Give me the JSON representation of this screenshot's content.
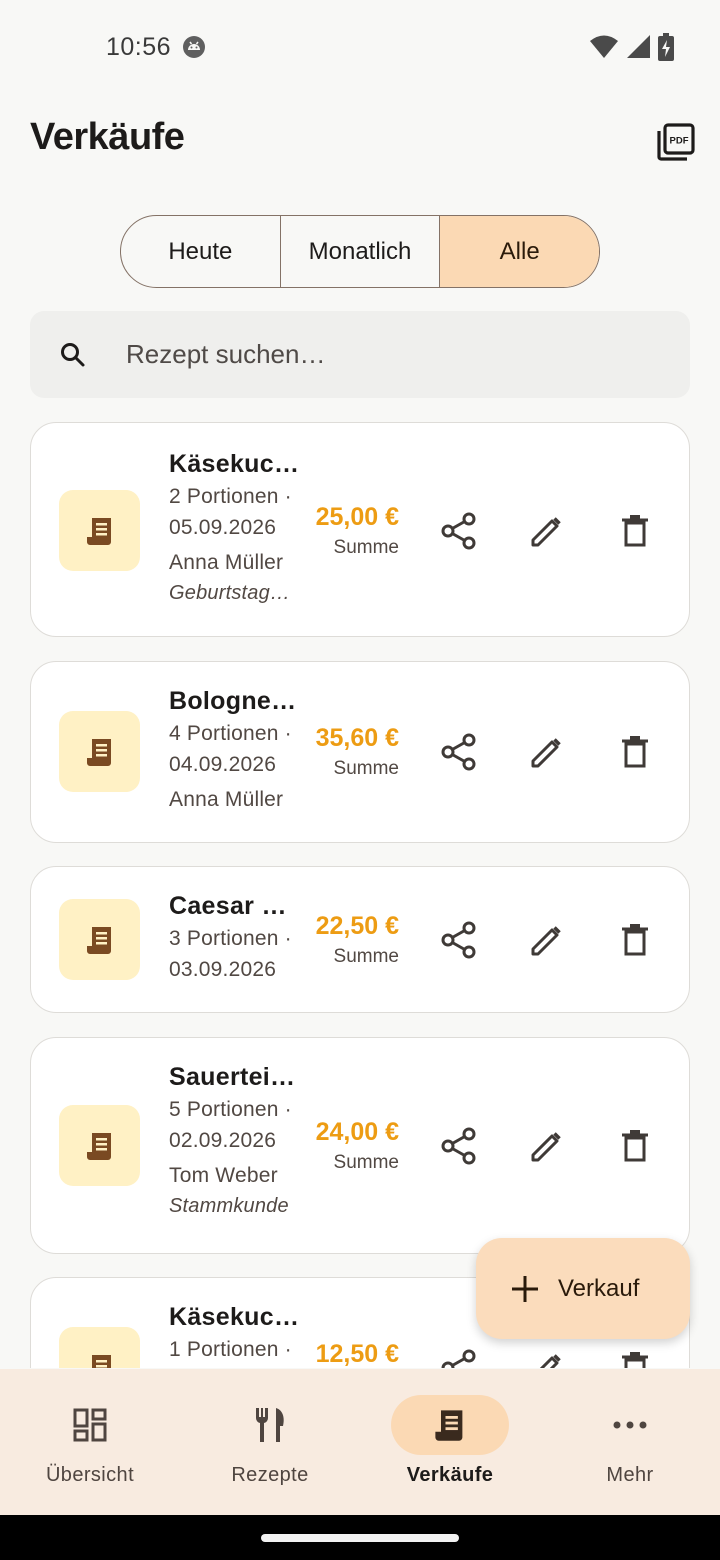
{
  "status_bar": {
    "time": "10:56"
  },
  "header": {
    "title": "Verkäufe"
  },
  "filter": {
    "options": [
      {
        "label": "Heute",
        "active": false
      },
      {
        "label": "Monatlich",
        "active": false
      },
      {
        "label": "Alle",
        "active": true
      }
    ]
  },
  "search": {
    "placeholder": "Rezept suchen…",
    "value": ""
  },
  "sales": [
    {
      "title": "Käsekuc…",
      "portions": "2 Portionen ·",
      "date": "05.09.2026",
      "customer": "Anna Müller",
      "note": "Geburtstag…",
      "amount": "25,00 €",
      "amount_label": "Summe"
    },
    {
      "title": "Bologne…",
      "portions": "4 Portionen ·",
      "date": "04.09.2026",
      "customer": "Anna Müller",
      "note": "",
      "amount": "35,60 €",
      "amount_label": "Summe"
    },
    {
      "title": "Caesar …",
      "portions": "3 Portionen ·",
      "date": "03.09.2026",
      "customer": "",
      "note": "",
      "amount": "22,50 €",
      "amount_label": "Summe"
    },
    {
      "title": "Sauertei…",
      "portions": "5 Portionen ·",
      "date": "02.09.2026",
      "customer": "Tom Weber",
      "note": "Stammkunde",
      "amount": "24,00 €",
      "amount_label": "Summe"
    },
    {
      "title": "Käsekuc…",
      "portions": "1 Portionen ·",
      "date": "",
      "customer": "",
      "note": "",
      "amount": "12,50 €",
      "amount_label": "Summe"
    }
  ],
  "fab": {
    "label": "Verkauf"
  },
  "nav": {
    "items": [
      {
        "label": "Übersicht",
        "icon": "dashboard-icon",
        "active": false
      },
      {
        "label": "Rezepte",
        "icon": "restaurant-icon",
        "active": false
      },
      {
        "label": "Verkäufe",
        "icon": "receipt-icon",
        "active": true
      },
      {
        "label": "Mehr",
        "icon": "more-horizontal-icon",
        "active": false
      }
    ]
  },
  "colors": {
    "accent_price": "#ed9c13",
    "selected_segment": "#fbd9b4",
    "card_icon_bg": "#fff1c5",
    "nav_bg": "#f8ebe0",
    "fab_bg": "#fbdcbc"
  }
}
